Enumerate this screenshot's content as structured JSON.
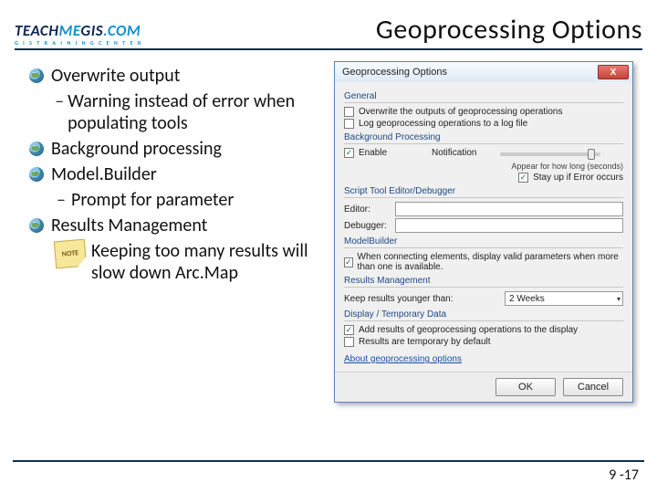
{
  "logo": {
    "teach": "TEACH",
    "me": "ME",
    "gis": "GIS",
    "dot": ".",
    "com": "COM",
    "tag": "G I S   T R A I N I N G   C E N T E R"
  },
  "title": "Geoprocessing Options",
  "bullets": {
    "b1": "Overwrite output",
    "b1s1": "Warning instead of error when populating tools",
    "b2": "Background processing",
    "b3": "Model.Builder",
    "b3s1": "Prompt for parameter",
    "b4": "Results Management",
    "note_label": "NOTE",
    "note_text": "Keeping too many results will slow down Arc.Map"
  },
  "dialog": {
    "title": "Geoprocessing Options",
    "close": "X",
    "groups": {
      "general": "General",
      "general_cb1": "Overwrite the outputs of geoprocessing operations",
      "general_cb2": "Log geoprocessing operations to a log file",
      "bg": "Background Processing",
      "bg_enable": "Enable",
      "bg_notif": "Notification",
      "bg_appear": "Appear for how long (seconds)",
      "bg_stay": "Stay up if Error occurs",
      "script": "Script Tool Editor/Debugger",
      "editor": "Editor:",
      "debugger": "Debugger:",
      "mb": "ModelBuilder",
      "mb_text": "When connecting elements, display valid parameters when more than one is available.",
      "res": "Results Management",
      "res_text": "Keep results younger than:",
      "res_value": "2 Weeks",
      "disp": "Display / Temporary Data",
      "disp_cb1": "Add results of geoprocessing operations to the display",
      "disp_cb2": "Results are temporary by default",
      "link": "About geoprocessing options"
    },
    "ok": "OK",
    "cancel": "Cancel"
  },
  "page": "9 -17"
}
